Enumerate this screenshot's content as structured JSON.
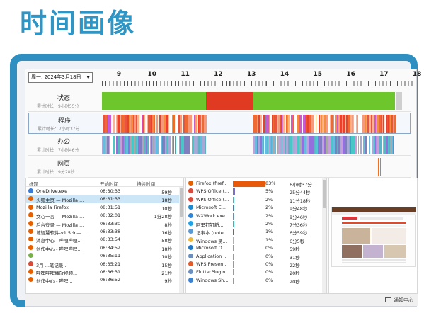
{
  "page_title": "时间画像",
  "toolbar": {
    "date_value": "周一, 2024年3月18日"
  },
  "ruler": {
    "hours": [
      "9",
      "10",
      "11",
      "12",
      "13",
      "14",
      "15",
      "16",
      "17",
      "18"
    ]
  },
  "rows": [
    {
      "label": "状态",
      "sub": "累计时长：9小时55分"
    },
    {
      "label": "程序",
      "sub": "累计时长：7小时37分"
    },
    {
      "label": "办公",
      "sub": "累计时长：7小时46分"
    },
    {
      "label": "网页",
      "sub": "累计时长：9分28秒"
    }
  ],
  "windows_table": {
    "headers": {
      "title": "标题",
      "start": "开始时间",
      "duration": "持续时间"
    },
    "rows": [
      {
        "title": "OneDrive.exe",
        "start": "08:30:33",
        "duration": "59秒",
        "icon": "onedrive-icon",
        "color": "#3a7bd5"
      },
      {
        "title": "火狐主页 — Mozilla ...",
        "start": "08:31:33",
        "duration": "18秒",
        "icon": "firefox-icon",
        "color": "#e66000"
      },
      {
        "title": "Mozilla Firefox",
        "start": "08:31:51",
        "duration": "10秒",
        "icon": "firefox-icon",
        "color": "#e66000"
      },
      {
        "title": "文心一言 — Mozilla ...",
        "start": "08:32:01",
        "duration": "1分28秒",
        "icon": "firefox-icon",
        "color": "#e66000"
      },
      {
        "title": "后台登录 — Mozilla ...",
        "start": "08:33:30",
        "duration": "8秒",
        "icon": "firefox-icon",
        "color": "#e66000"
      },
      {
        "title": "城智慧软件-v1.5.9 — ...",
        "start": "08:33:38",
        "duration": "16秒",
        "icon": "firefox-icon",
        "color": "#e66000"
      },
      {
        "title": "消息中心 - 哔哩哔哩...",
        "start": "08:33:54",
        "duration": "58秒",
        "icon": "firefox-icon",
        "color": "#e66000"
      },
      {
        "title": "创作中心 - 哔哩哔哩...",
        "start": "08:34:52",
        "duration": "18秒",
        "icon": "firefox-icon",
        "color": "#e66000"
      },
      {
        "title": "",
        "start": "08:35:11",
        "duration": "10秒",
        "icon": "app-icon",
        "color": "#78b04a"
      },
      {
        "title": "3月 ...笔记录...",
        "start": "08:35:21",
        "duration": "15秒",
        "icon": "wps-icon",
        "color": "#d84a3a"
      },
      {
        "title": "哔哩哔哩播放视频...",
        "start": "08:36:31",
        "duration": "21秒",
        "icon": "firefox-icon",
        "color": "#e66000"
      },
      {
        "title": "创作中心 - 哔哩...",
        "start": "08:36:52",
        "duration": "9秒",
        "icon": "firefox-icon",
        "color": "#e66000"
      }
    ]
  },
  "apps_table": {
    "rows": [
      {
        "name": "Firefox (firef...",
        "pct": "83%",
        "pct_value": 83,
        "time": "6小时37分",
        "icon": "firefox-icon",
        "color": "#e66000",
        "bar": "#e85a0a"
      },
      {
        "name": "WPS Office (...",
        "pct": "5%",
        "pct_value": 5,
        "time": "25分44秒",
        "icon": "wps-icon",
        "color": "#d84a3a",
        "bar": "#7d6ccf"
      },
      {
        "name": "WPS Office (...",
        "pct": "2%",
        "pct_value": 2,
        "time": "11分18秒",
        "icon": "wps-icon",
        "color": "#d84a3a",
        "bar": "#39b6c7"
      },
      {
        "name": "Microsoft E...",
        "pct": "2%",
        "pct_value": 2,
        "time": "9分48秒",
        "icon": "edge-icon",
        "color": "#1b8ad3",
        "bar": "#2f7fd8"
      },
      {
        "name": "WXWork.exe",
        "pct": "2%",
        "pct_value": 2,
        "time": "9分46秒",
        "icon": "wxwork-icon",
        "color": "#2f86d8",
        "bar": "#5d8bd6"
      },
      {
        "name": "阿里钉钉新...",
        "pct": "2%",
        "pct_value": 2,
        "time": "7分36秒",
        "icon": "dingtalk-icon",
        "color": "#1fa3e6",
        "bar": "#2cbcb0"
      },
      {
        "name": "记事本 (note...",
        "pct": "1%",
        "pct_value": 1,
        "time": "6分59秒",
        "icon": "notepad-icon",
        "color": "#5b9bd5",
        "bar": "#6a6a6a"
      },
      {
        "name": "Windows 资...",
        "pct": "1%",
        "pct_value": 1,
        "time": "6分5秒",
        "icon": "explorer-icon",
        "color": "#f0b93a",
        "bar": "#b0b0b0"
      },
      {
        "name": "Microsoft O...",
        "pct": "0%",
        "pct_value": 0,
        "time": "59秒",
        "icon": "office-icon",
        "color": "#1f77c4",
        "bar": "#999999"
      },
      {
        "name": "Application ...",
        "pct": "0%",
        "pct_value": 0,
        "time": "31秒",
        "icon": "app-icon",
        "color": "#6a8fbf",
        "bar": "#999999"
      },
      {
        "name": "WPS Presen...",
        "pct": "0%",
        "pct_value": 0,
        "time": "22秒",
        "icon": "wps-present-icon",
        "color": "#e35a2b",
        "bar": "#999999"
      },
      {
        "name": "FlutterPlugin...",
        "pct": "0%",
        "pct_value": 0,
        "time": "20秒",
        "icon": "app-icon",
        "color": "#6a8fbf",
        "bar": "#999999"
      },
      {
        "name": "Windows Sh...",
        "pct": "0%",
        "pct_value": 0,
        "time": "20秒",
        "icon": "windows-icon",
        "color": "#3a83d4",
        "bar": "#999999"
      }
    ]
  },
  "statusbar": {
    "notify_label": "通知中心"
  },
  "colors": {
    "status_active": "#6cc62c",
    "status_idle": "#e03a22",
    "program_palette": [
      "#ef6a32",
      "#f59a7a",
      "#e8412c",
      "#ffb196",
      "#c85bd4",
      "#f38e3a",
      "#ffffff",
      "#e9543d"
    ],
    "office_palette": [
      "#a9a9d8",
      "#9370db",
      "#48c7c7",
      "#66bbe0",
      "#a9a9a9",
      "#ffffff",
      "#7f7fbf",
      "#5eb2c4",
      "#c79fd8"
    ],
    "web_mark": "#f07020"
  }
}
